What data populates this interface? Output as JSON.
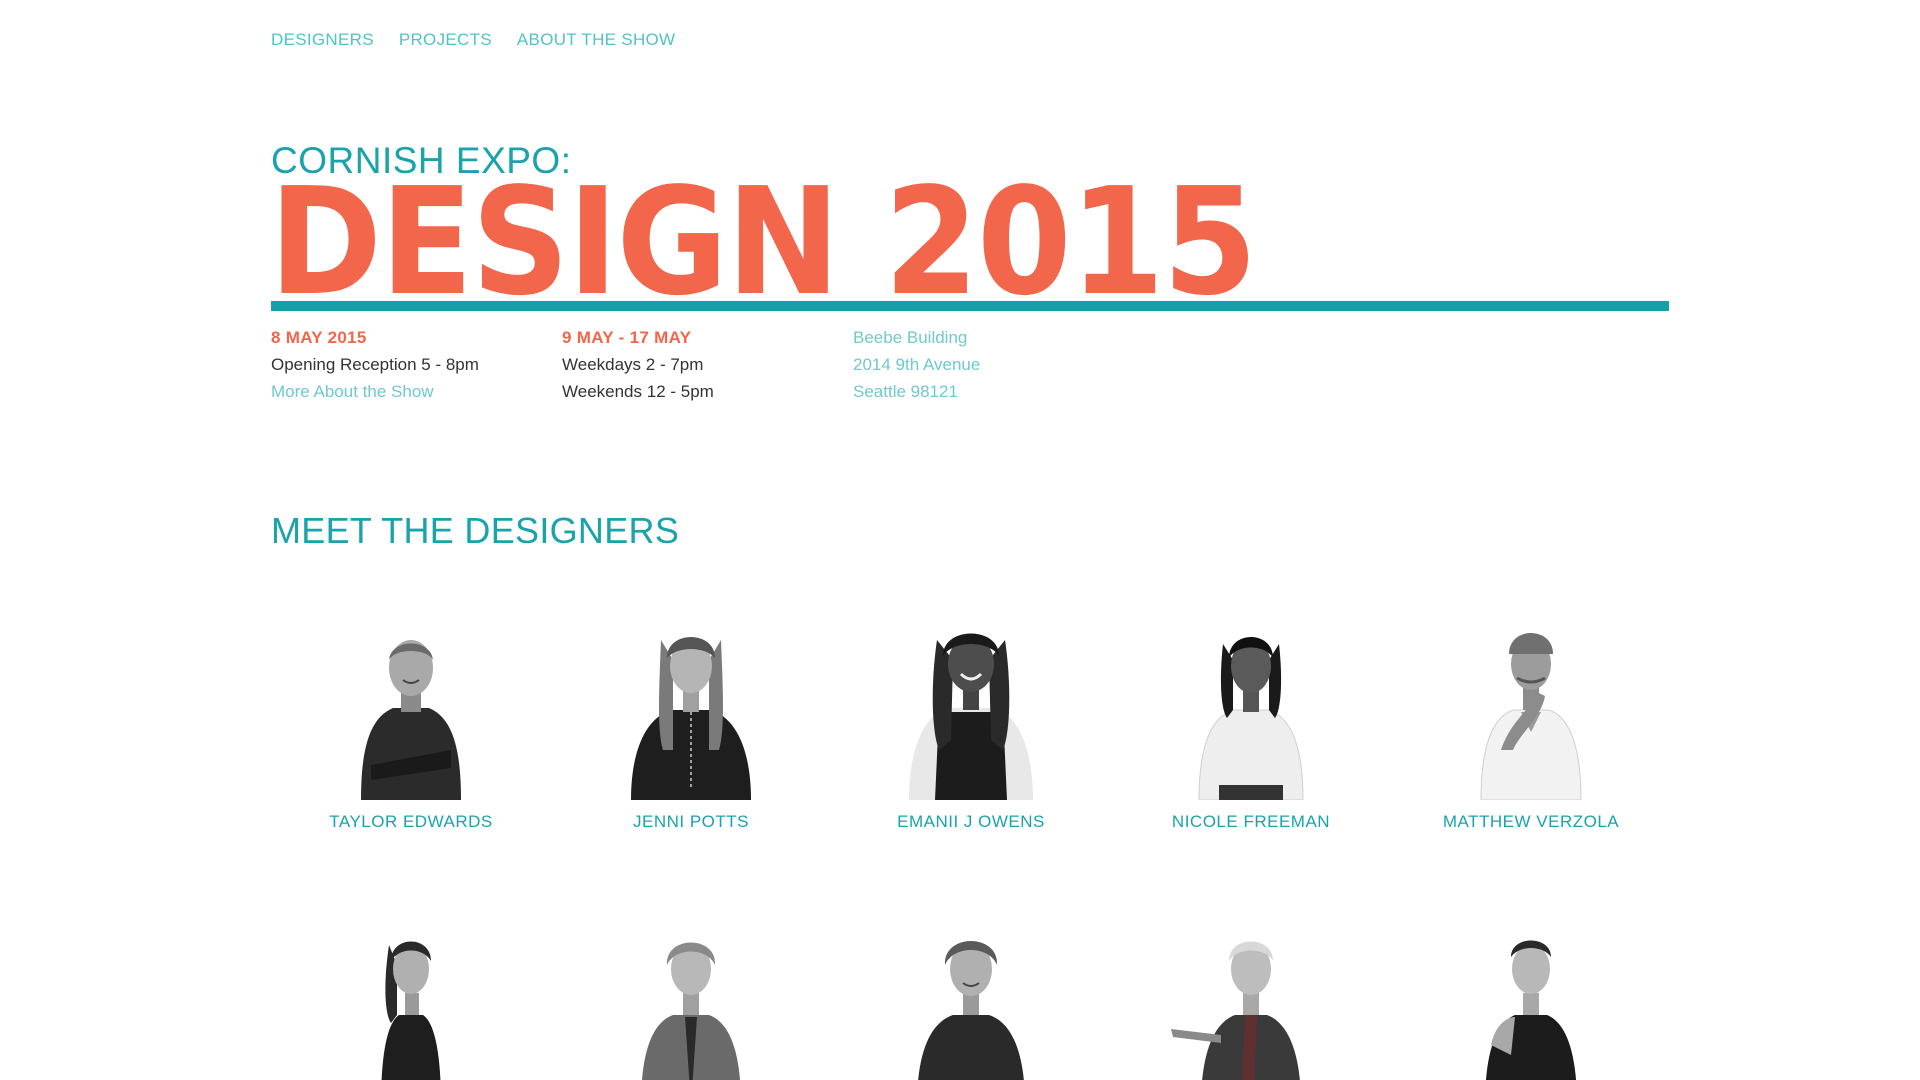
{
  "nav": {
    "items": [
      {
        "label": "DESIGNERS"
      },
      {
        "label": "PROJECTS"
      },
      {
        "label": "ABOUT THE SHOW"
      }
    ]
  },
  "hero": {
    "kicker": "CORNISH EXPO:",
    "title": "DESIGN 2015"
  },
  "info": {
    "opening": {
      "date": "8 MAY 2015",
      "line": "Opening Reception 5 - 8pm",
      "link": "More About the Show"
    },
    "run": {
      "date": "9 MAY - 17 MAY",
      "weekdays": "Weekdays 2 - 7pm",
      "weekends": "Weekends 12 - 5pm"
    },
    "venue": {
      "building": "Beebe Building",
      "street": "2014 9th Avenue",
      "city": "Seattle 98121"
    }
  },
  "designers": {
    "title": "MEET THE DESIGNERS",
    "row1": [
      {
        "name": "TAYLOR EDWARDS"
      },
      {
        "name": "JENNI POTTS"
      },
      {
        "name": "EMANII J OWENS"
      },
      {
        "name": "NICOLE FREEMAN"
      },
      {
        "name": "MATTHEW VERZOLA"
      }
    ],
    "row2": [
      {
        "name": ""
      },
      {
        "name": ""
      },
      {
        "name": ""
      },
      {
        "name": ""
      },
      {
        "name": ""
      }
    ]
  },
  "colors": {
    "accent_teal": "#1aa3aa",
    "accent_coral": "#f2664b",
    "link_light_teal": "#6fc9cd"
  }
}
